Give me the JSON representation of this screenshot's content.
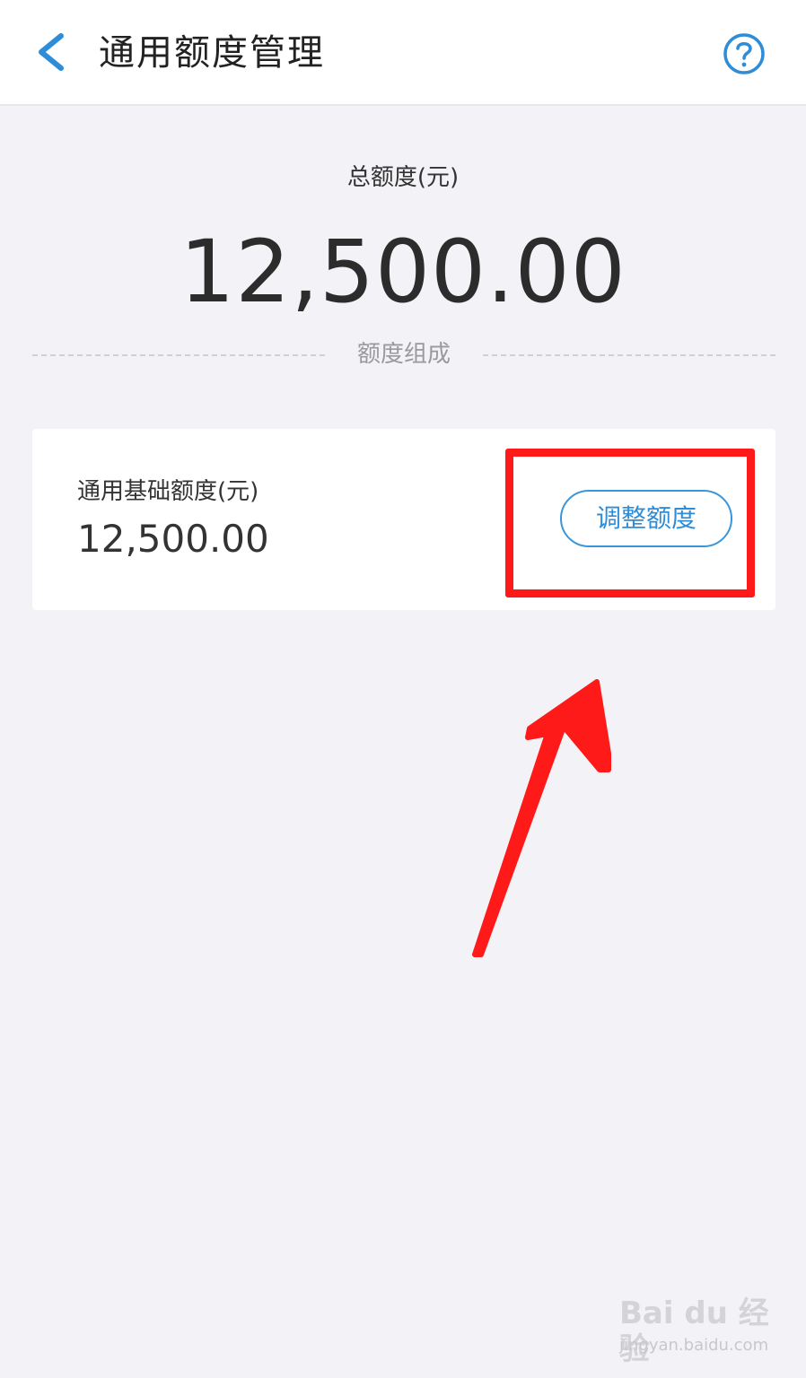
{
  "header": {
    "title": "通用额度管理",
    "back_icon": "chevron-left-icon",
    "help_icon": "question-circle-icon"
  },
  "summary": {
    "total_label": "总额度(元)",
    "total_value": "12,500.00"
  },
  "divider": {
    "label": "额度组成"
  },
  "base_credit": {
    "label": "通用基础额度(元)",
    "value": "12,500.00",
    "adjust_button": "调整额度"
  },
  "watermark": {
    "logo": "Bai du 经验",
    "url": "jingyan.baidu.com"
  },
  "colors": {
    "accent": "#2f8cd6",
    "annotation": "#ff1a1a",
    "background": "#f3f3f7"
  }
}
